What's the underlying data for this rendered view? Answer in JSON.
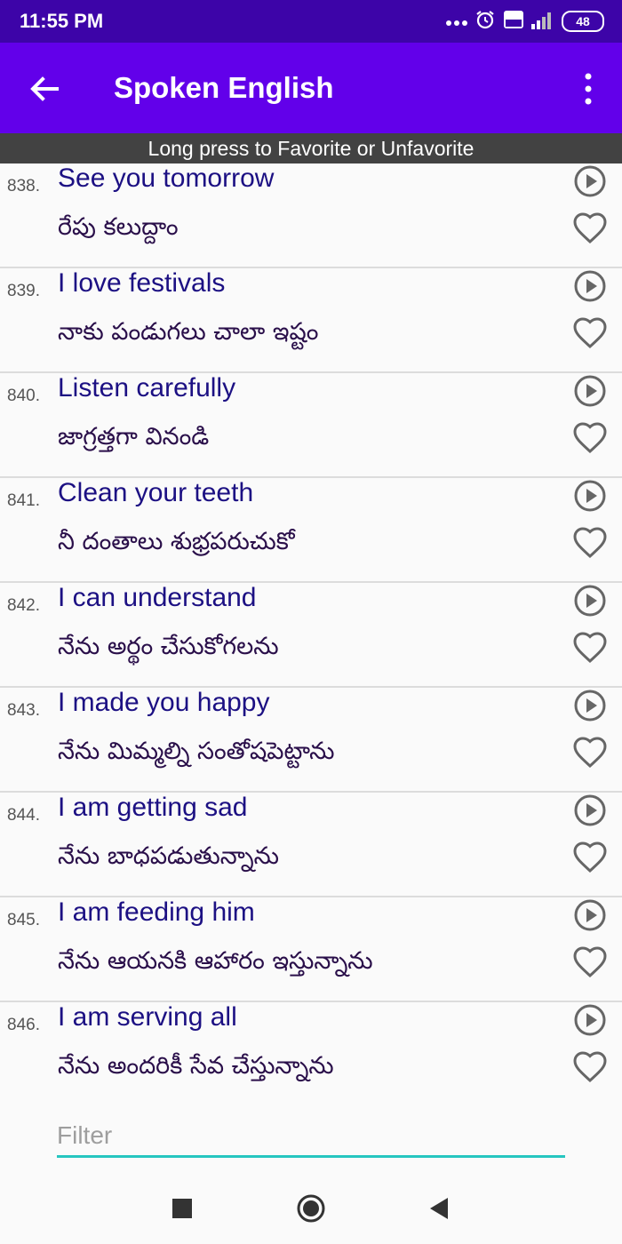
{
  "status_bar": {
    "time": "11:55 PM",
    "battery": "48",
    "icons": [
      "more-dots-icon",
      "alarm-icon",
      "volte-icon",
      "signal-icon",
      "battery-icon"
    ]
  },
  "app_bar": {
    "title": "Spoken English",
    "back_icon": "arrow-back-icon",
    "menu_icon": "more-vert-icon",
    "background": "#6200ea"
  },
  "hint": "Long press to Favorite or Unfavorite",
  "phrases": [
    {
      "num": "838.",
      "english": "See you tomorrow",
      "telugu": "రేపు కలుద్దాం"
    },
    {
      "num": "839.",
      "english": "I love festivals",
      "telugu": "నాకు పండుగలు చాలా ఇష్టం"
    },
    {
      "num": "840.",
      "english": "Listen carefully",
      "telugu": "జాగ్రత్తగా వినండి"
    },
    {
      "num": "841.",
      "english": "Clean your teeth",
      "telugu": "నీ దంతాలు శుభ్రపరుచుకో"
    },
    {
      "num": "842.",
      "english": "I can understand",
      "telugu": "నేను అర్థం చేసుకోగలను"
    },
    {
      "num": "843.",
      "english": "I made you happy",
      "telugu": "నేను మిమ్మల్ని సంతోషపెట్టాను"
    },
    {
      "num": "844.",
      "english": "I am getting sad",
      "telugu": "నేను బాధపడుతున్నాను"
    },
    {
      "num": "845.",
      "english": "I am feeding him",
      "telugu": "నేను ఆయనకి ఆహారం ఇస్తున్నాను"
    },
    {
      "num": "846.",
      "english": "I am serving all",
      "telugu": "నేను అందరికీ సేవ చేస్తున్నాను"
    }
  ],
  "filter": {
    "placeholder": "Filter",
    "value": ""
  },
  "nav_bar": {
    "icons": [
      "recent-apps-icon",
      "home-icon",
      "back-icon"
    ]
  },
  "colors": {
    "status_bar": "#3d04a8",
    "app_bar": "#6200ea",
    "english_text": "#1c1083",
    "accent_line": "#26c6c0"
  }
}
